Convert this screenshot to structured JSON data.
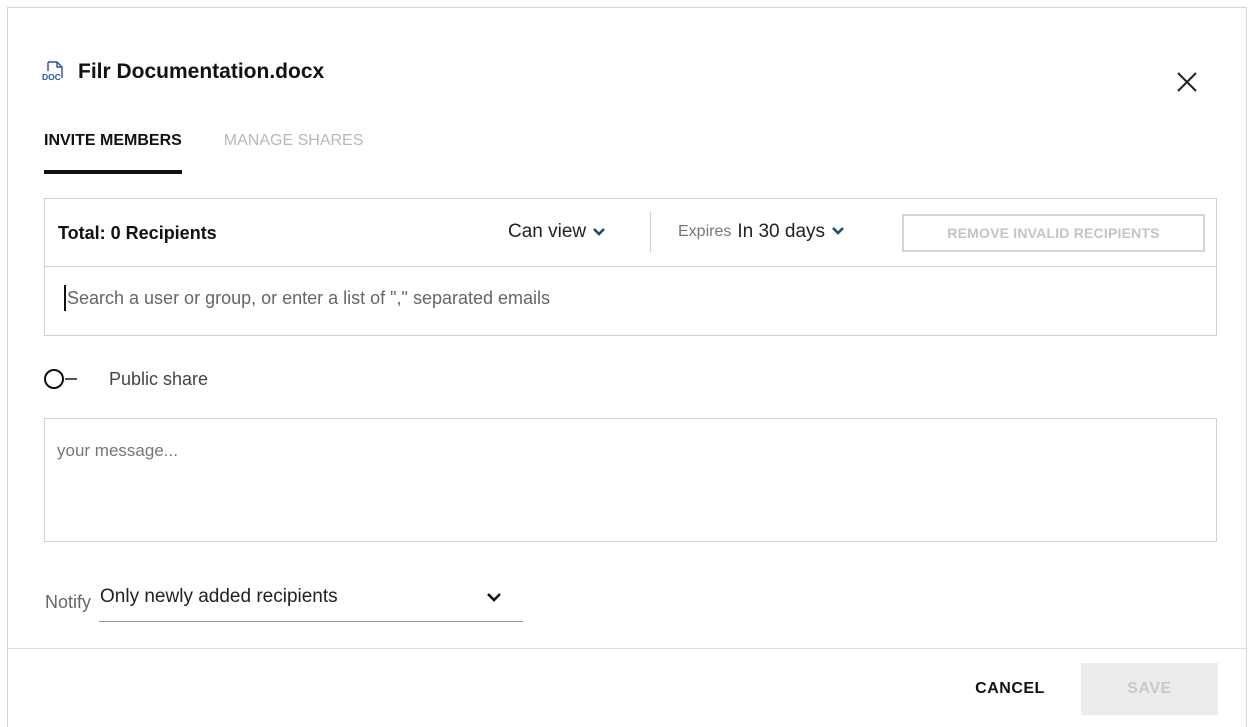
{
  "dialog": {
    "title": "Filr Documentation.docx",
    "file_icon_label": "DOC",
    "file_icon": "word-document-icon",
    "close_icon": "close-icon"
  },
  "tabs": [
    {
      "label": "INVITE MEMBERS",
      "active": true
    },
    {
      "label": "MANAGE SHARES",
      "active": false
    }
  ],
  "recipients": {
    "total_label": "Total: 0 Recipients",
    "permission": "Can view",
    "expires_label": "Expires",
    "expires_value": "In 30 days",
    "remove_invalid_label": "REMOVE INVALID RECIPIENTS",
    "search_placeholder": "Search a user or group, or enter a list of \",\" separated emails"
  },
  "public_share": {
    "label": "Public share",
    "enabled": false
  },
  "message": {
    "placeholder": "your message..."
  },
  "notify": {
    "label": "Notify",
    "value": "Only newly added recipients"
  },
  "footer": {
    "cancel_label": "CANCEL",
    "save_label": "SAVE"
  },
  "colors": {
    "accent_chevron": "#1b4d6b",
    "doc_icon_blue": "#2b4fa8",
    "disabled_text": "#c4c4c4"
  }
}
